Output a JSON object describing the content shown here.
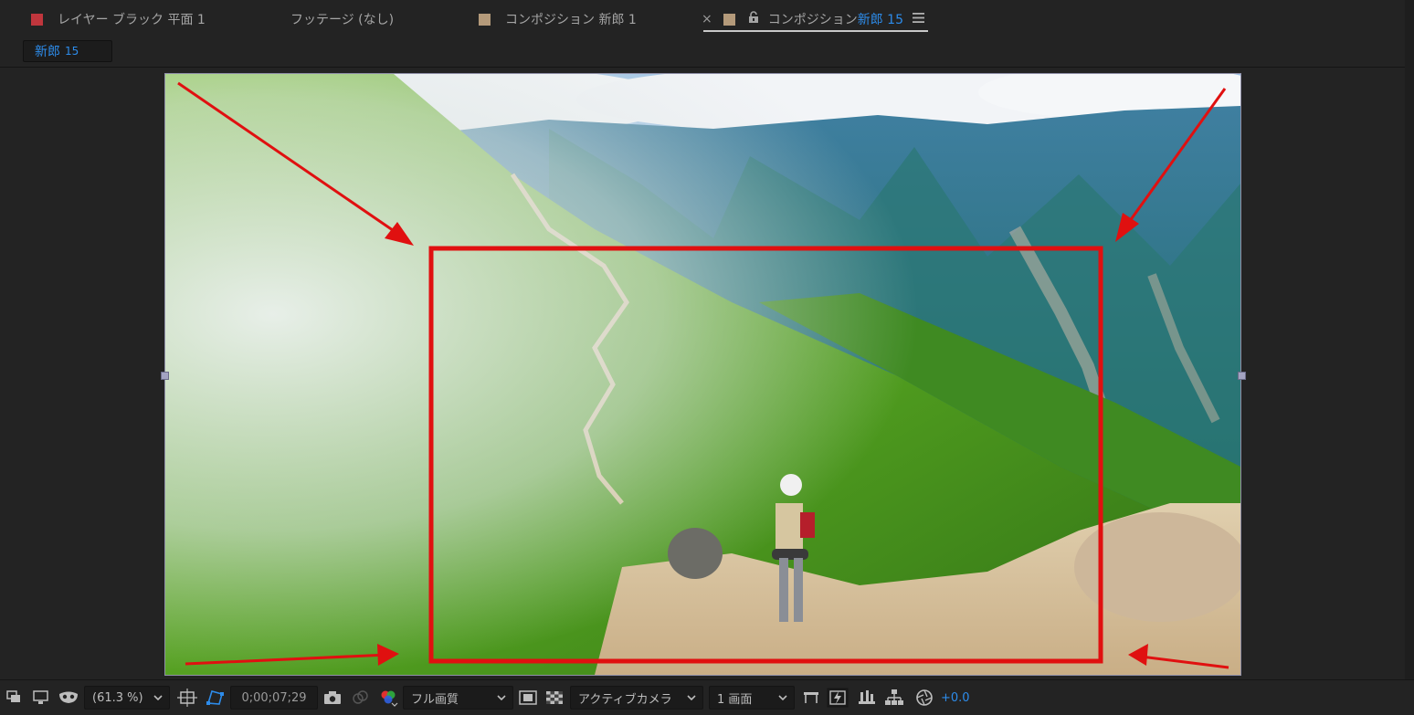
{
  "tabs": [
    {
      "label": "レイヤー ブラック 平面 1",
      "swatch_color": "#c0363d",
      "active": false
    },
    {
      "label": "フッテージ (なし)",
      "swatch_color": "",
      "active": false
    },
    {
      "label": "コンポジション 新郎 1",
      "swatch_color": "#b49a7a",
      "active": false
    },
    {
      "label_prefix": "コンポジション ",
      "label_accent": "新郎 15",
      "swatch_color": "#b49a7a",
      "active": true,
      "close_symbol": "×"
    }
  ],
  "breadcrumb": {
    "name": "新郎",
    "number": "15"
  },
  "viewer": {
    "icons": [
      "arrow-icon",
      "selection-rectangle"
    ],
    "annotation_color": "#e01010"
  },
  "toolbar": {
    "zoom": "(61.3 %)",
    "timecode": "0;00;07;29",
    "resolution": "フル画質",
    "camera": "アクティブカメラ",
    "views": "1 画面",
    "exposure": "+0.0",
    "accent_color": "#2d8ceb"
  }
}
